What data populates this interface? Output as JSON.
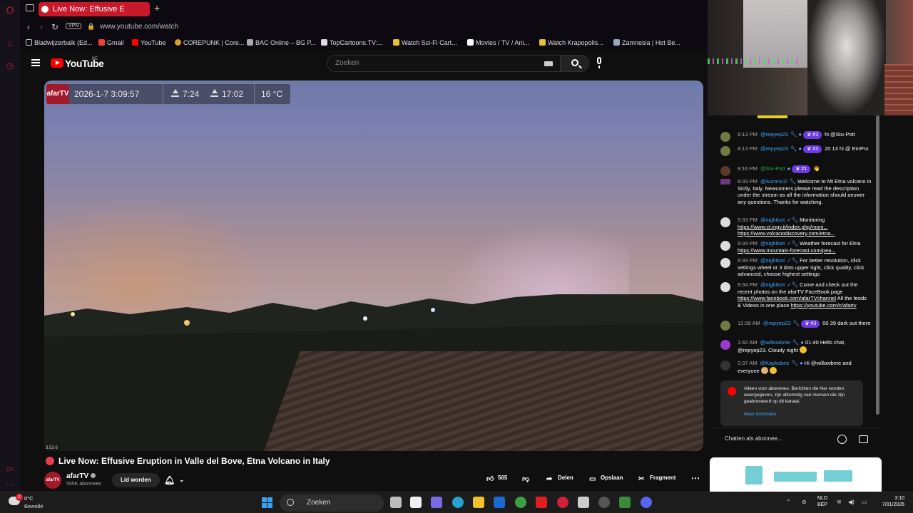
{
  "browser": {
    "tab_title": "Live Now: Effusive E",
    "url": "www.youtube.com/watch",
    "vpn_label": "VPN",
    "bookmarks": [
      "Bladwijzerbalk (Ed...",
      "Gmail",
      "YouTube",
      "COREPUNK | Core...",
      "BAC Online – BG P...",
      "TopCartoons.TV:...",
      "Watch Sci-Fi Cart...",
      "Movies / TV / Ani...",
      "Watch Krapopolis...",
      "Zamnesia | Het Be..."
    ]
  },
  "youtube": {
    "logo_text": "YouTube",
    "region": "BE",
    "search_placeholder": "Zoeken"
  },
  "video": {
    "overlay": {
      "brand": "afarTV",
      "datetime": "2026-1-7  3:09:57",
      "sunrise": "7:24",
      "sunset": "17:02",
      "temperature": "16 °C"
    },
    "corner_stat": "3.53  6",
    "title": "Live Now: Effusive Eruption in Valle del Bove, Etna Volcano in Italy",
    "channel": {
      "avatar_text": "afarTV",
      "name": "afarTV",
      "subscribers": "555K abonnees"
    },
    "join_label": "Lid worden",
    "likes": "565",
    "share_label": "Delen",
    "save_label": "Opslaan",
    "clip_label": "Fragment"
  },
  "chat": {
    "messages": [
      {
        "time": "8:13 PM",
        "author": "@repyep23",
        "badge": "#3",
        "text": "hi @Stu-Pott"
      },
      {
        "time": "8:13 PM",
        "author": "@repyep23",
        "badge": "#3",
        "text": "20 13 hi @ EmPro"
      },
      {
        "time": "9:16 PM",
        "author": "@Stu-Pott",
        "badge": "#1",
        "text": "👋"
      },
      {
        "time": "9:33 PM",
        "author": "@Aurora.D",
        "badge": "",
        "text": "Welcome to Mt Etna volcano in Sicily, Italy. Newcomers please read the description under the stream as all the information should answer any questions. Thanks for watching."
      },
      {
        "time": "9:33 PM",
        "author": "@nightbot",
        "badge": "",
        "text": "Monitoring",
        "links": "https://www.ct.ingv.it/index.php/moni... https://www.volcanodiscovery.com/etna..."
      },
      {
        "time": "9:34 PM",
        "author": "@nightbot",
        "badge": "",
        "text": "Weather forecast for Etna",
        "links": "https://www.mountain-forecast.com/pea..."
      },
      {
        "time": "9:34 PM",
        "author": "@nightbot",
        "badge": "",
        "text": "For better resolution, click settings wheel or 3 dots upper right, click quality, click advanced, choose highest settings"
      },
      {
        "time": "9:34 PM",
        "author": "@nightbot",
        "badge": "",
        "text": "Come and check out the recent photos on the afarTV FaceBook page",
        "links": "https://www.facebook.com/afarTVchannel",
        "text2": "All the feeds & Videos in one place",
        "links2": "https://youtube.com/c/afartv"
      },
      {
        "time": "12:39 AM",
        "author": "@repyep23",
        "badge": "#3",
        "text": "00 39 dark out there"
      },
      {
        "time": "1:42 AM",
        "author": "@willowbme",
        "badge": "",
        "text": "01:40 Hello chat, @repyep23. Cloudy night"
      },
      {
        "time": "2:37 AM",
        "author": "@Kaykobee",
        "badge": "",
        "text": "Hi @willowbme and everyone"
      }
    ],
    "subscribers_only_notice": "Alleen voor abonnees. Berichten die hier worden weergegeven, zijn afkomstig van mensen die zijn geabonneerd op dit kanaal.",
    "more_info": "Meer informatie",
    "input_placeholder": "Chatten als abonnee..."
  },
  "taskbar": {
    "weather_temp": "0°C",
    "weather_cond": "Bewolkt",
    "weather_badge": "2",
    "search_label": "Zoeken",
    "lang_line1": "NLD",
    "lang_line2": "BEP",
    "time": "3:10",
    "date": "7/01/2026"
  },
  "colors": {
    "youtube_red": "#ff0000",
    "opera_red": "#c8182a",
    "afar_red": "#a2192c",
    "badge_purple": "#6b3ae0"
  }
}
